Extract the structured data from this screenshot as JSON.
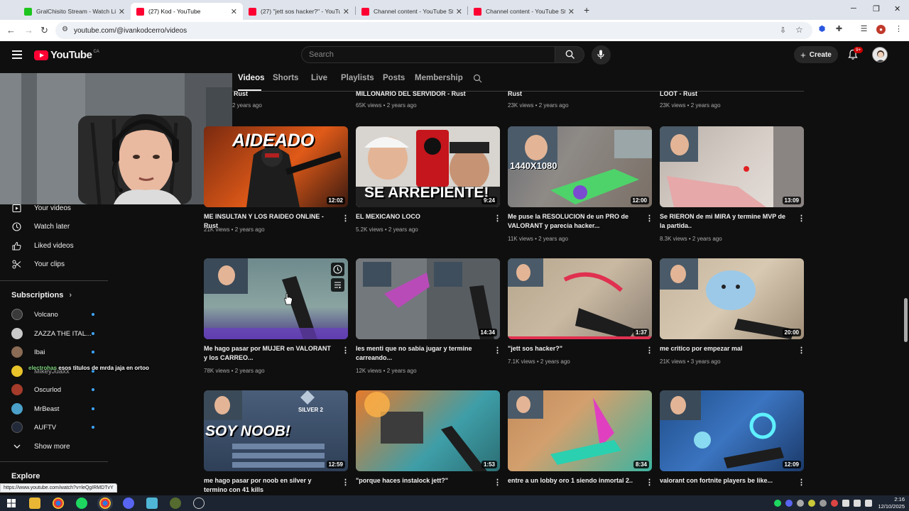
{
  "browser": {
    "tabs": [
      {
        "title": "GralChisito Stream - Watch Live...",
        "favicon_color": "#1ec51e",
        "active": false
      },
      {
        "title": "(27) Kod - YouTube",
        "favicon_color": "#ff0033",
        "active": true
      },
      {
        "title": "(27) \"jett sos hacker?\" - YouTube",
        "favicon_color": "#ff0033",
        "active": false
      },
      {
        "title": "Channel content - YouTube Studio",
        "favicon_color": "#ff0033",
        "active": false
      },
      {
        "title": "Channel content - YouTube Studio",
        "favicon_color": "#ff0033",
        "active": false
      }
    ],
    "url": "youtube.com/@ivankodcerro/videos"
  },
  "header": {
    "logo_text": "YouTube",
    "country_code": "CA",
    "search_placeholder": "Search",
    "create_label": "Create",
    "notification_count": "9+"
  },
  "channel_tabs": [
    "Videos",
    "Shorts",
    "Live",
    "Playlists",
    "Posts",
    "Membership"
  ],
  "sidebar": {
    "items": [
      {
        "label": "Your videos",
        "icon": "play-square-icon"
      },
      {
        "label": "Watch later",
        "icon": "clock-icon"
      },
      {
        "label": "Liked videos",
        "icon": "thumbs-up-icon"
      },
      {
        "label": "Your clips",
        "icon": "scissors-icon"
      }
    ],
    "subscriptions_heading": "Subscriptions",
    "subscriptions": [
      {
        "name": "Volcano",
        "color": "#3a3a3a"
      },
      {
        "name": "ZAZZA THE ITAL...",
        "color": "#c9c9c9"
      },
      {
        "name": "Ibai",
        "color": "#8a6b55"
      },
      {
        "name": "MikeyJuaxx",
        "color": "#e8c32a"
      },
      {
        "name": "Oscurlod",
        "color": "#a53b2a"
      },
      {
        "name": "MrBeast",
        "color": "#4aa0c8"
      },
      {
        "name": "AUFTV",
        "color": "#222a3a"
      }
    ],
    "show_more": "Show more",
    "explore_heading": "Explore"
  },
  "chat_overlay": {
    "user": "electrohas",
    "message": "esos titulos de mrda jaja en ortoo"
  },
  "videos": {
    "row0": [
      {
        "title": "Rust",
        "meta": "2 years ago"
      },
      {
        "title": "MILLONARIO DEL SERVIDOR - Rust",
        "meta": "65K views • 2 years ago"
      },
      {
        "title": "Rust",
        "meta": "23K views • 2 years ago"
      },
      {
        "title": "LOOT - Rust",
        "meta": "23K views • 2 years ago"
      }
    ],
    "row1": [
      {
        "title": "ME INSULTAN Y LOS RAIDEO ONLINE - Rust",
        "meta": "21K views • 2 years ago",
        "duration": "12:02",
        "overlay": "AIDEADO"
      },
      {
        "title": "EL MEXICANO LOCO",
        "meta": "5.2K views • 2 years ago",
        "duration": "9:24",
        "overlay": "SE ARREPIENTE!"
      },
      {
        "title": "Me puse la RESOLUCION de un PRO de VALORANT y parecia hacker...",
        "meta": "11K views • 2 years ago",
        "duration": "12:00",
        "overlay": "1440X1080"
      },
      {
        "title": "Se RIERON de mi MIRA y termine MVP de la partida..",
        "meta": "8.3K views • 2 years ago",
        "duration": "13:09",
        "overlay": ""
      }
    ],
    "row2": [
      {
        "title": "Me hago pasar por MUJER en VALORANT y los CARREO...",
        "meta": "78K views • 2 years ago",
        "duration": "",
        "overlay": ""
      },
      {
        "title": "les menti que no sabia jugar y termine carreando...",
        "meta": "12K views • 2 years ago",
        "duration": "14:34",
        "overlay": ""
      },
      {
        "title": "\"jett sos hacker?\"",
        "meta": "7.1K views • 2 years ago",
        "duration": "1:37",
        "overlay": ""
      },
      {
        "title": "me critico por empezar mal",
        "meta": "21K views • 3 years ago",
        "duration": "20:00",
        "overlay": ""
      }
    ],
    "row3": [
      {
        "title": "me hago pasar por noob en silver y termino con 41 kills",
        "meta": "",
        "duration": "12:59",
        "overlay": "SOY NOOB!",
        "badge": "SILVER 2"
      },
      {
        "title": "\"porque haces instalock jett?\"",
        "meta": "",
        "duration": "1:53",
        "overlay": ""
      },
      {
        "title": "entre a un lobby oro 1 siendo inmortal 2..",
        "meta": "",
        "duration": "8:34",
        "overlay": ""
      },
      {
        "title": "valorant con fortnite players be like...",
        "meta": "",
        "duration": "12:09",
        "overlay": ""
      }
    ]
  },
  "status_bar_url": "https://www.youtube.com/watch?v=leQgIRMDTvY",
  "taskbar": {
    "time": "2:16",
    "date": "12/10/2025"
  }
}
